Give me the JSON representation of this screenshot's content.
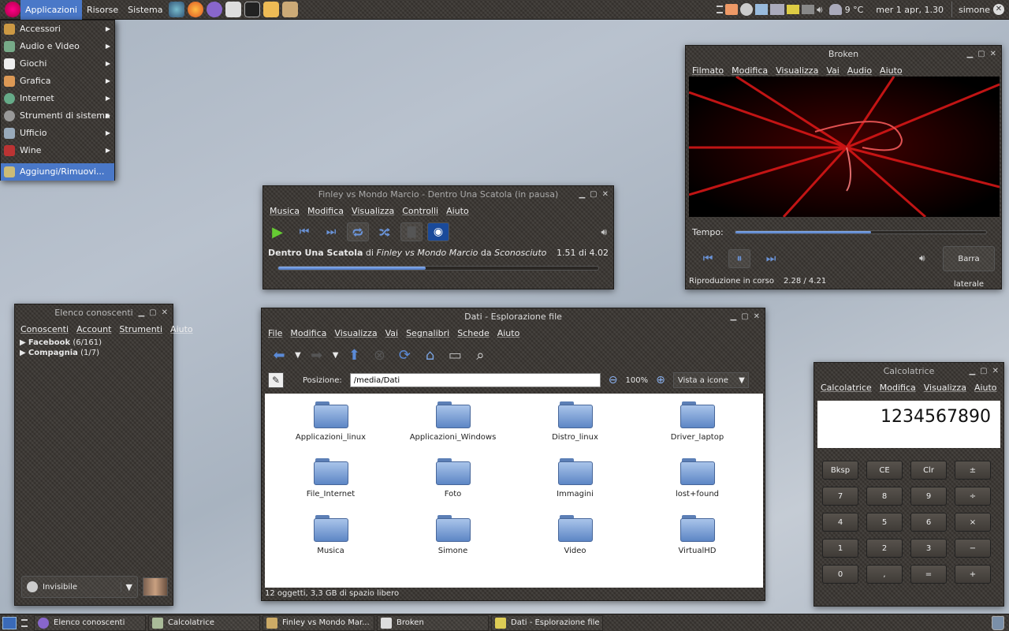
{
  "top_panel": {
    "menus": [
      "Applicazioni",
      "Risorse",
      "Sistema"
    ],
    "weather": "9 °C",
    "clock": "mer 1 apr, 1.30",
    "user": "simone"
  },
  "app_menu": {
    "items": [
      {
        "label": "Accessori",
        "icon": "accessories-icon"
      },
      {
        "label": "Audio e Video",
        "icon": "multimedia-icon"
      },
      {
        "label": "Giochi",
        "icon": "games-icon"
      },
      {
        "label": "Grafica",
        "icon": "graphics-icon"
      },
      {
        "label": "Internet",
        "icon": "internet-icon"
      },
      {
        "label": "Strumenti di sistema",
        "icon": "system-tools-icon"
      },
      {
        "label": "Ufficio",
        "icon": "office-icon"
      },
      {
        "label": "Wine",
        "icon": "wine-icon"
      }
    ],
    "add_remove": "Aggiungi/Rimuovi..."
  },
  "music_player": {
    "title": "Finley vs Mondo Marcio - Dentro Una Scatola (in pausa)",
    "menus": [
      "Musica",
      "Modifica",
      "Visualizza",
      "Controlli",
      "Aiuto"
    ],
    "track": "Dentro Una Scatola",
    "di": "di",
    "artist": "Finley vs Mondo Marcio",
    "da": "da",
    "album": "Sconosciuto",
    "time": "1.51 di 4.02",
    "progress": 0.46
  },
  "video_player": {
    "title": "Broken",
    "menus": [
      "Filmato",
      "Modifica",
      "Visualizza",
      "Vai",
      "Audio",
      "Aiuto"
    ],
    "time_label": "Tempo:",
    "progress": 0.54,
    "sidebar_button": "Barra laterale",
    "status": "Riproduzione in corso",
    "time": "2.28 / 4.21"
  },
  "contacts": {
    "title": "Elenco conoscenti",
    "menus": [
      "Conoscenti",
      "Account",
      "Strumenti",
      "Aiuto"
    ],
    "groups": [
      {
        "name": "Facebook",
        "count": "(6/161)"
      },
      {
        "name": "Compagnia",
        "count": "(1/7)"
      }
    ],
    "status": "Invisibile"
  },
  "file_browser": {
    "title": "Dati - Esplorazione file",
    "menus": [
      "File",
      "Modifica",
      "Visualizza",
      "Vai",
      "Segnalibri",
      "Schede",
      "Aiuto"
    ],
    "location_label": "Posizione:",
    "location": "/media/Dati",
    "zoom": "100%",
    "view_mode": "Vista a icone",
    "items": [
      "Applicazioni_linux",
      "Applicazioni_Windows",
      "Distro_linux",
      "Driver_laptop",
      "File_Internet",
      "Foto",
      "Immagini",
      "lost+found",
      "Musica",
      "Simone",
      "Video",
      "VirtualHD"
    ],
    "status": "12 oggetti, 3,3 GB di spazio libero"
  },
  "calculator": {
    "title": "Calcolatrice",
    "menus": [
      "Calcolatrice",
      "Modifica",
      "Visualizza",
      "Aiuto"
    ],
    "display": "1234567890",
    "rows": [
      [
        "Bksp",
        "CE",
        "Clr",
        "±"
      ],
      [
        "7",
        "8",
        "9",
        "÷"
      ],
      [
        "4",
        "5",
        "6",
        "×"
      ],
      [
        "1",
        "2",
        "3",
        "−"
      ],
      [
        "0",
        ",",
        "=",
        "+"
      ]
    ]
  },
  "taskbar": {
    "tasks": [
      "Elenco conoscenti",
      "Calcolatrice",
      "Finley vs Mondo Mar...",
      "Broken",
      "Dati - Esplorazione file"
    ]
  },
  "colors": {
    "accent": "#4a78c8",
    "link_blue": "#6a93d8"
  }
}
